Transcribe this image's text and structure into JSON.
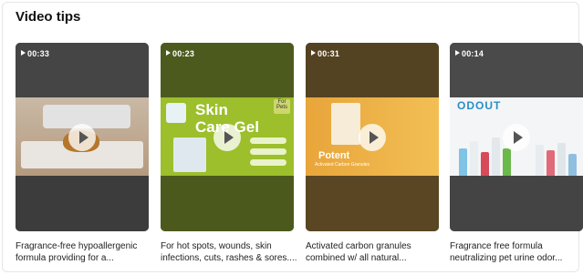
{
  "section": {
    "title": "Video tips"
  },
  "cards": [
    {
      "duration": "00:33",
      "caption_lines": [
        "Fragrance-free hypoallergenic",
        "formula providing for a..."
      ],
      "thumb_text": []
    },
    {
      "duration": "00:23",
      "caption_lines": [
        "For hot spots, wounds, skin",
        "infections, cuts, rashes & sores...."
      ],
      "thumb_text": [
        "Skin",
        "Care Gel",
        "For Pets"
      ]
    },
    {
      "duration": "00:31",
      "caption_lines": [
        "Activated carbon granules",
        "combined w/ all natural..."
      ],
      "thumb_text": [
        "Potent",
        "Activated Carbon Granules"
      ]
    },
    {
      "duration": "00:14",
      "caption_lines": [
        "Fragrance free formula",
        "neutralizing pet urine odor..."
      ],
      "thumb_text": [
        "ODOUT"
      ]
    }
  ],
  "icons": {
    "play": "play-icon",
    "duration": "play-triangle-icon"
  }
}
